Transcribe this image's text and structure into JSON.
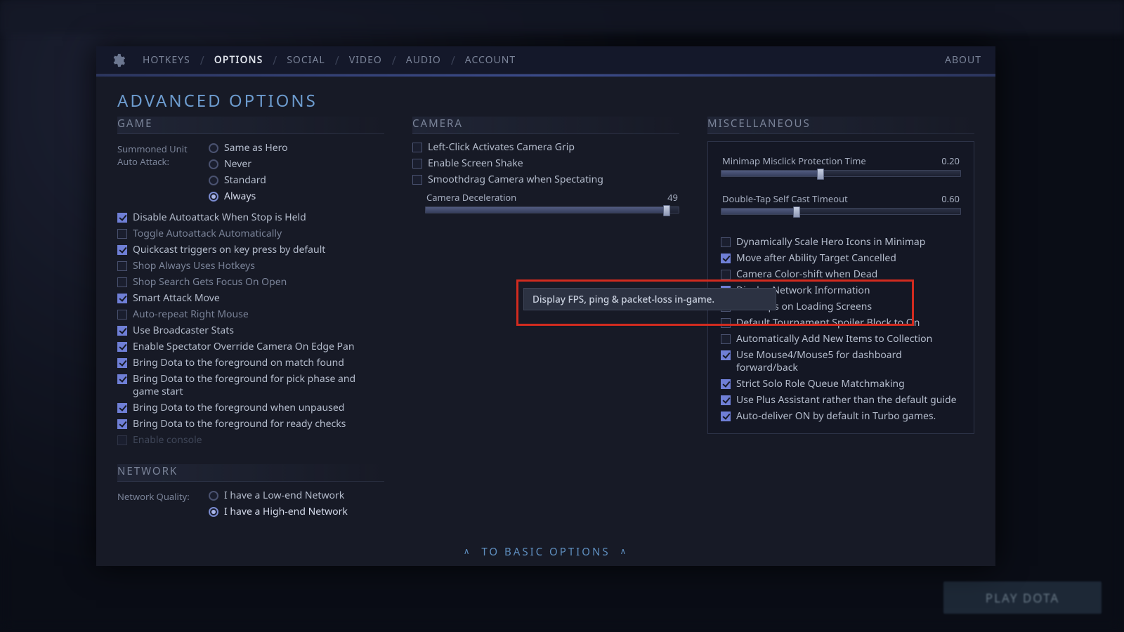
{
  "nav": {
    "tabs": [
      "HOTKEYS",
      "OPTIONS",
      "SOCIAL",
      "VIDEO",
      "AUDIO",
      "ACCOUNT"
    ],
    "active": 1,
    "about": "ABOUT"
  },
  "title": "ADVANCED OPTIONS",
  "game": {
    "header": "GAME",
    "summoned_label": "Summoned Unit Auto Attack:",
    "summoned_opts": [
      "Same as Hero",
      "Never",
      "Standard",
      "Always"
    ],
    "summoned_selected": 3,
    "checks": [
      {
        "label": "Disable Autoattack When Stop is Held",
        "on": true
      },
      {
        "label": "Toggle Autoattack Automatically",
        "on": false,
        "dim": true
      },
      {
        "label": "Quickcast triggers on key press by default",
        "on": true
      },
      {
        "label": "Shop Always Uses Hotkeys",
        "on": false,
        "dim": true
      },
      {
        "label": "Shop Search Gets Focus On Open",
        "on": false,
        "dim": true
      },
      {
        "label": "Smart Attack Move",
        "on": true
      },
      {
        "label": "Auto-repeat Right Mouse",
        "on": false,
        "dim": true
      },
      {
        "label": "Use Broadcaster Stats",
        "on": true
      },
      {
        "label": "Enable Spectator Override Camera On Edge Pan",
        "on": true
      },
      {
        "label": "Bring Dota to the foreground on match found",
        "on": true
      },
      {
        "label": "Bring Dota to the foreground for pick phase and game start",
        "on": true
      },
      {
        "label": "Bring Dota to the foreground when unpaused",
        "on": true
      },
      {
        "label": "Bring Dota to the foreground for ready checks",
        "on": true
      },
      {
        "label": "Enable console",
        "on": false,
        "disabled": true
      }
    ]
  },
  "network": {
    "header": "NETWORK",
    "quality_label": "Network Quality:",
    "opts": [
      "I have a Low-end Network",
      "I have a High-end Network"
    ],
    "selected": 1
  },
  "camera": {
    "header": "CAMERA",
    "checks": [
      {
        "label": "Left-Click Activates Camera Grip",
        "on": false
      },
      {
        "label": "Enable Screen Shake",
        "on": false
      },
      {
        "label": "Smoothdrag Camera when Spectating",
        "on": false
      }
    ],
    "decel_label": "Camera Deceleration",
    "decel_value": 49
  },
  "misc": {
    "header": "MISCELLANEOUS",
    "sliders": [
      {
        "label": "Minimap Misclick Protection Time",
        "value": "0.20",
        "pct": 40
      },
      {
        "label": "Double-Tap Self Cast Timeout",
        "value": "0.60",
        "pct": 30
      }
    ],
    "checks": [
      {
        "label": "Dynamically Scale Hero Icons in Minimap",
        "on": false
      },
      {
        "label": "Move after Ability Target Cancelled",
        "on": true
      },
      {
        "label": "Camera Color-shift when Dead",
        "on": false
      },
      {
        "label": "Display Network Information",
        "on": true
      },
      {
        "label": "Hide Tips on Loading Screens",
        "on": false
      },
      {
        "label": "Default Tournament Spoiler Block to On",
        "on": false
      },
      {
        "label": "Automatically Add New Items to Collection",
        "on": false
      },
      {
        "label": "Use Mouse4/Mouse5 for dashboard forward/back",
        "on": true
      },
      {
        "label": "Strict Solo Role Queue Matchmaking",
        "on": true
      },
      {
        "label": "Use Plus Assistant rather than the default guide",
        "on": true
      },
      {
        "label": "Auto-deliver ON by default in Turbo games.",
        "on": true
      }
    ]
  },
  "tooltip": "Display FPS, ping & packet-loss in-game.",
  "bottom": "TO BASIC OPTIONS",
  "play": "PLAY DOTA"
}
